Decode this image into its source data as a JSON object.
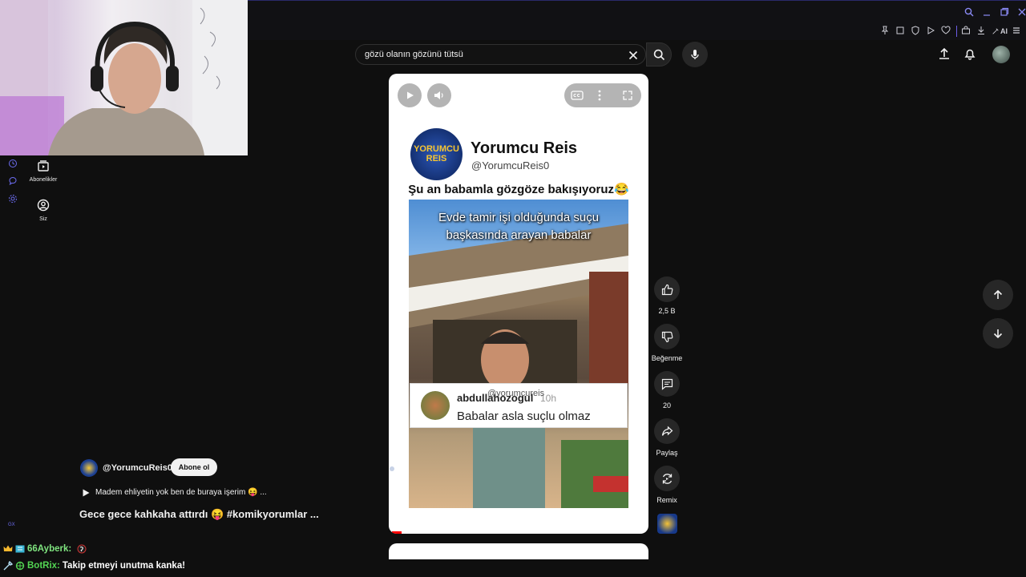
{
  "search": {
    "query": "gözü olanın gözünü tütsü"
  },
  "sidebar": {
    "items": [
      {
        "label": "Abonelikler",
        "icon": "subscriptions-icon"
      },
      {
        "label": "Siz",
        "icon": "account-icon"
      }
    ],
    "footer": "GX"
  },
  "browser": {
    "ai_label": "AI"
  },
  "short": {
    "post": {
      "name": "Yorumcu Reis",
      "handle": "@YorumcuReis0",
      "text": "Şu an babamla gözgöze bakışıyoruz😂",
      "logo_text": "YORUMCU REIS"
    },
    "video": {
      "caption": "Evde tamir işi olduğunda suçu başkasında arayan babalar",
      "comment_user": "abdullahozogul",
      "comment_time": "10h",
      "comment_watermark": "@yorumcureis",
      "comment_text": "Babalar asla suçlu olmaz"
    }
  },
  "actions": {
    "like_count": "2,5 B",
    "dislike_label": "Beğenme",
    "comment_count": "20",
    "share_label": "Paylaş",
    "remix_label": "Remix"
  },
  "channel": {
    "handle": "@YorumcuReis0",
    "subscribe_label": "Abone ol",
    "music": "Madem ehliyetin yok ben de buraya işerim 😝 ...",
    "title": "Gece gece kahkaha attırdı 😝 #komikyorumlar ..."
  },
  "chat": [
    {
      "user": "66Ayberk:",
      "message": "",
      "user_color": "#7fe37f"
    },
    {
      "user": "BotRix:",
      "message": "Takip etmeyi unutma kanka!",
      "user_color": "#53d653"
    }
  ]
}
